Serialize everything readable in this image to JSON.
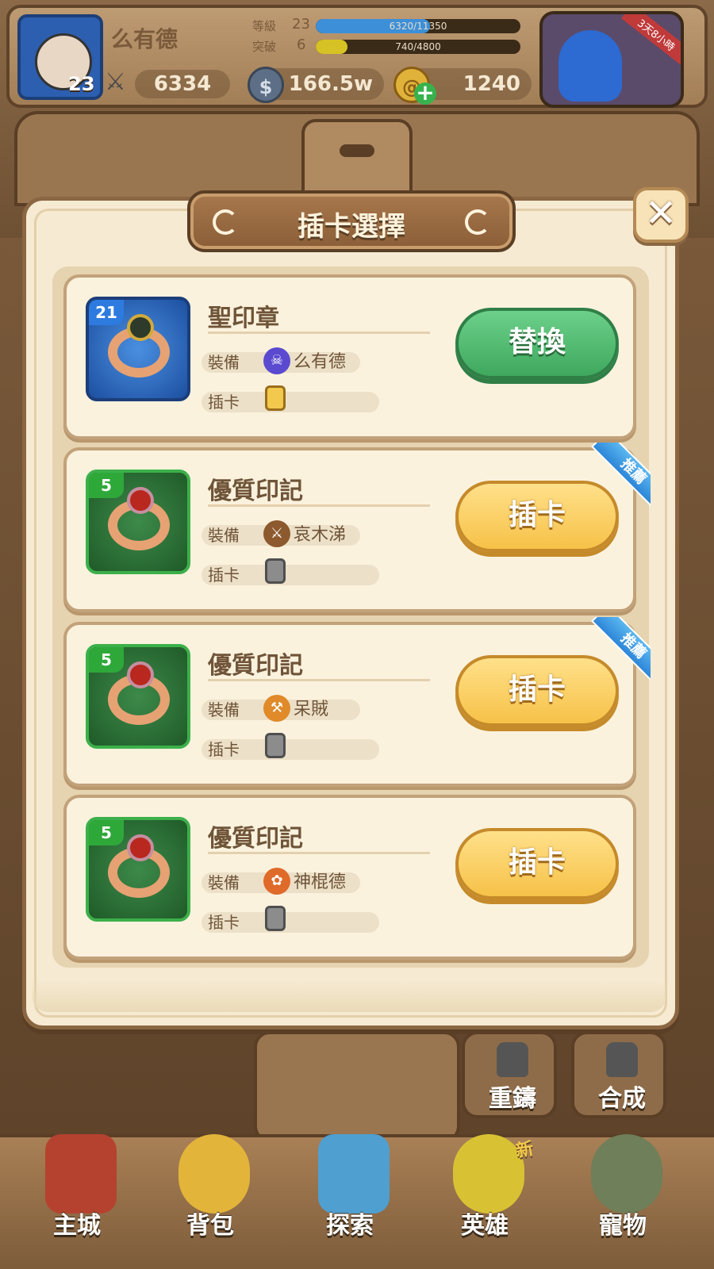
{
  "header": {
    "player_name": "么有德",
    "player_level": "23",
    "power": "6334",
    "level_label": "等級",
    "level_value": "23",
    "level_exp": "6320/11350",
    "level_progress": 0.557,
    "breakthrough_label": "突破",
    "breakthrough_value": "6",
    "breakthrough_exp": "740/4800",
    "breakthrough_progress": 0.154,
    "silver": "166.5w",
    "gold": "1240",
    "event_timer": "3天8小時"
  },
  "dialog": {
    "title": "插卡選擇",
    "close_symbol": "✕",
    "items": [
      {
        "name": "聖印章",
        "level": "21",
        "rarity": "blue",
        "equip_label": "裝備",
        "equip_hero": "么有德",
        "card_label": "插卡",
        "card_type": "gold",
        "button": "替換",
        "button_color": "green",
        "recommended": false
      },
      {
        "name": "優質印記",
        "level": "5",
        "rarity": "green",
        "equip_label": "裝備",
        "equip_hero": "哀木涕",
        "card_label": "插卡",
        "card_type": "grey",
        "button": "插卡",
        "button_color": "yellow",
        "recommended": true,
        "tag": "推薦"
      },
      {
        "name": "優質印記",
        "level": "5",
        "rarity": "green",
        "equip_label": "裝備",
        "equip_hero": "呆賊",
        "card_label": "插卡",
        "card_type": "grey",
        "button": "插卡",
        "button_color": "yellow",
        "recommended": true,
        "tag": "推薦"
      },
      {
        "name": "優質印記",
        "level": "5",
        "rarity": "green",
        "equip_label": "裝備",
        "equip_hero": "神棍德",
        "card_label": "插卡",
        "card_type": "grey",
        "button": "插卡",
        "button_color": "yellow",
        "recommended": false
      }
    ]
  },
  "side_buttons": {
    "reforge": "重鑄",
    "synthesize": "合成"
  },
  "nav": {
    "main_city": "主城",
    "backpack": "背包",
    "explore": "探索",
    "heroes": "英雄",
    "pets": "寵物",
    "new_badge": "新"
  },
  "colors": {
    "green_button": "#3fa85e",
    "yellow_button": "#f6c248",
    "blue_rarity": "#2e7be0",
    "green_rarity": "#2fa83a",
    "dialog_bg": "#f6ead2",
    "recommend_tag": "#2d86d8"
  }
}
